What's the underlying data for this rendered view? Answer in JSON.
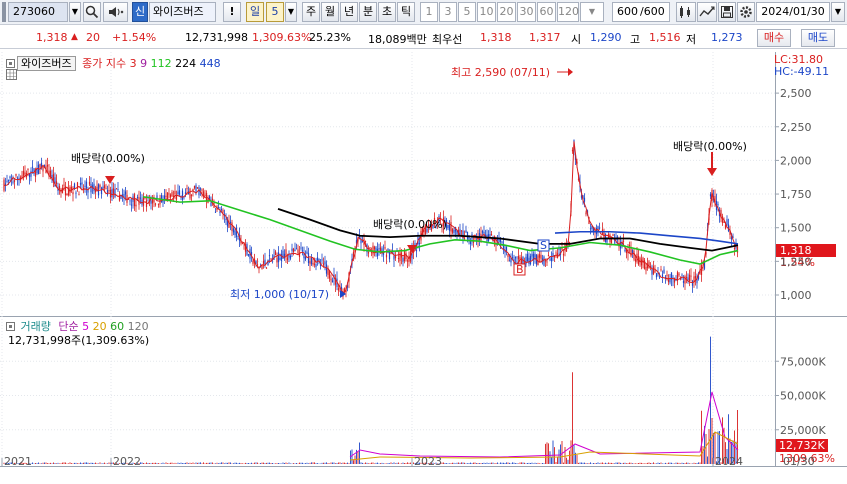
{
  "toolbar": {
    "stock_code": "273060",
    "search_icon": "search-icon",
    "sound_icon": "speaker-icon",
    "credit_badge": "신",
    "stock_name": "와이즈버즈",
    "alert_label": "!",
    "period_selected": "일",
    "period_value": "5",
    "period_tabs": [
      "주",
      "월",
      "년",
      "분",
      "초",
      "틱"
    ],
    "interval_buttons": [
      "1",
      "3",
      "5",
      "10",
      "20",
      "30",
      "60",
      "120"
    ],
    "count_display": "600",
    "count_total": "/600",
    "date": "2024/01/30"
  },
  "quote": {
    "price": "1,318",
    "change": "20",
    "change_pct": "+1.54%",
    "volume": "12,731,998",
    "volume_ratio": "1,309.63%",
    "turnover": "25.23%",
    "amount": "18,089백만",
    "bid_label": "최우선",
    "bid1": "1,318",
    "bid2": "1,317",
    "open_label": "시",
    "open": "1,290",
    "high_label": "고",
    "high": "1,516",
    "low_label": "저",
    "low": "1,273",
    "buy_label": "매수",
    "sell_label": "매도"
  },
  "price_panel": {
    "name": "와이즈버즈",
    "ma_legend": "종가 지수",
    "ma_periods": [
      "3",
      "9",
      "112",
      "224",
      "448"
    ],
    "ma_colors": [
      "#d91f1f",
      "#a020a0",
      "#22c322",
      "#000000",
      "#1c46c8"
    ],
    "lc": "LC:31.80",
    "hc": "HC:-49.11",
    "annotations": {
      "high": "최고 2,590 (07/11)",
      "low": "최저 1,000 (10/17)",
      "dividend_1": "배당락(0.00%)",
      "dividend_2": "배당락(0.00%)",
      "dividend_3": "배당락(0.00%)"
    },
    "y_ticks": [
      "2,500",
      "2,250",
      "2,000",
      "1,750",
      "1,500",
      "1,250",
      "1,000"
    ],
    "current_price_tag": "1,318",
    "current_pct_tag": "1.54%",
    "markers": [
      "S",
      "B"
    ]
  },
  "volume_panel": {
    "title": "거래량",
    "ma_legend": "단순",
    "ma_periods": [
      "5",
      "20",
      "60",
      "120"
    ],
    "ma_colors": [
      "#d000d0",
      "#d8a000",
      "#22a022",
      "#777777"
    ],
    "current": "12,731,998주(1,309.63%)",
    "y_ticks": [
      "75,000K",
      "50,000K",
      "25,000K"
    ],
    "current_tag": "12,732K",
    "pct_tag": "1309.63%"
  },
  "x_axis": {
    "labels": [
      "2021",
      "2022",
      "2023",
      "2024"
    ],
    "end_label": "01/30"
  },
  "colors": {
    "up": "#d91f1f",
    "down": "#1c46c8",
    "ma112": "#22c322",
    "ma224": "#000000",
    "ma448": "#1c46c8"
  }
}
